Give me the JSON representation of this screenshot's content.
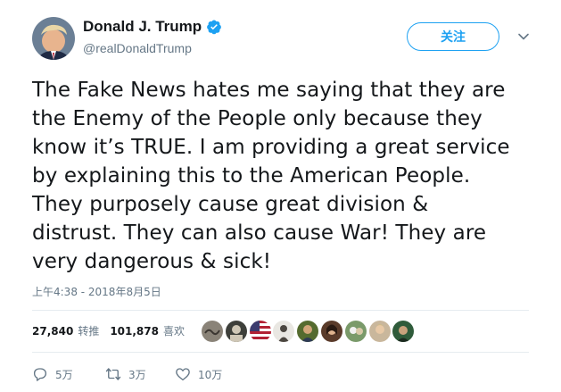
{
  "author": {
    "display_name": "Donald J. Trump",
    "handle": "@realDonaldTrump",
    "verified": true
  },
  "follow_button": {
    "label": "关注"
  },
  "tweet": {
    "lines": [
      "The Fake News hates me saying that they are",
      "the Enemy of the People only because they",
      "know it’s TRUE. I am providing a great service",
      "by explaining this to the American People.",
      "They purposely cause great division &",
      "distrust. They can also cause War! They are",
      "very dangerous & sick!"
    ],
    "timestamp": "上午4:38 - 2018年8月5日"
  },
  "stats": {
    "retweets_count": "27,840",
    "retweets_label": "转推",
    "likes_count": "101,878",
    "likes_label": "喜欢"
  },
  "actions": {
    "replies": "5万",
    "retweets": "3万",
    "likes": "10万"
  },
  "colors": {
    "accent": "#1da1f2",
    "text": "#14171a",
    "secondary": "#657786",
    "divider": "#e6ecf0"
  },
  "icons": [
    "verified-badge-icon",
    "chevron-down-icon",
    "reply-icon",
    "retweet-icon",
    "heart-icon"
  ]
}
